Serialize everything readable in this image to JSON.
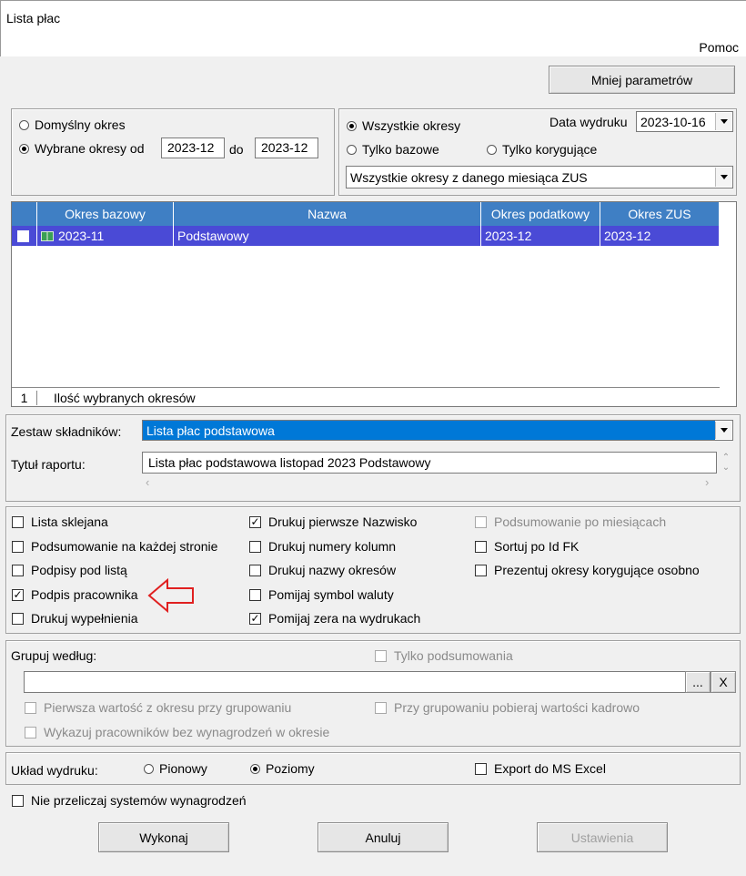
{
  "window": {
    "title": "Lista płac",
    "help": "Pomoc"
  },
  "toggle_params_button": "Mniej parametrów",
  "periods": {
    "default_label": "Domyślny  okres",
    "selected_label": "Wybrane okresy od",
    "from": "2023-12",
    "to_label": "do",
    "to": "2023-12"
  },
  "period_filter": {
    "all_label": "Wszystkie okresy",
    "base_label": "Tylko bazowe",
    "corr_label": "Tylko korygujące",
    "print_date_label": "Data wydruku",
    "print_date": "2023-10-16",
    "zus_combo": "Wszystkie okresy z danego miesiąca ZUS"
  },
  "grid": {
    "headers": [
      "Okres bazowy",
      "Nazwa",
      "Okres podatkowy",
      "Okres ZUS"
    ],
    "row": {
      "base": "2023-11",
      "name": "Podstawowy",
      "tax": "2023-12",
      "zus": "2023-12"
    },
    "footer_count": "1",
    "footer_label": "Ilość wybranych okresów"
  },
  "components": {
    "set_label": "Zestaw składników:",
    "set_value": "Lista płac podstawowa",
    "title_label": "Tytuł raportu:",
    "title_value": "Lista płac podstawowa listopad 2023 Podstawowy"
  },
  "options": {
    "col1": [
      {
        "label": "Lista sklejana",
        "checked": false
      },
      {
        "label": "Podsumowanie na każdej stronie",
        "checked": false
      },
      {
        "label": "Podpisy pod listą",
        "checked": false
      },
      {
        "label": "Podpis pracownika",
        "checked": true
      },
      {
        "label": "Drukuj wypełnienia",
        "checked": false
      }
    ],
    "col2": [
      {
        "label": "Drukuj pierwsze Nazwisko",
        "checked": true
      },
      {
        "label": "Drukuj numery kolumn",
        "checked": false
      },
      {
        "label": "Drukuj nazwy okresów",
        "checked": false
      },
      {
        "label": "Pomijaj symbol waluty",
        "checked": false
      },
      {
        "label": "Pomijaj zera na wydrukach",
        "checked": true
      }
    ],
    "col3": [
      {
        "label": "Podsumowanie po miesiącach",
        "checked": false,
        "disabled": true
      },
      {
        "label": "Sortuj po Id FK",
        "checked": false
      },
      {
        "label": "Prezentuj okresy korygujące osobno",
        "checked": false
      }
    ]
  },
  "grouping": {
    "label": "Grupuj według:",
    "only_summary": "Tylko podsumowania",
    "value": "",
    "ellipsis": "...",
    "clear": "X",
    "first_value": "Pierwsza wartość z okresu przy grupowaniu",
    "hr_values": "Przy grupowaniu pobieraj wartości kadrowo",
    "no_salary": "Wykazuj pracowników bez wynagrodzeń w okresie"
  },
  "layout": {
    "label": "Układ wydruku:",
    "portrait": "Pionowy",
    "landscape": "Poziomy",
    "excel": "Export do MS Excel"
  },
  "no_recalc": "Nie przeliczaj systemów wynagrodzeń",
  "actions": {
    "run": "Wykonaj",
    "cancel": "Anuluj",
    "settings": "Ustawienia"
  }
}
